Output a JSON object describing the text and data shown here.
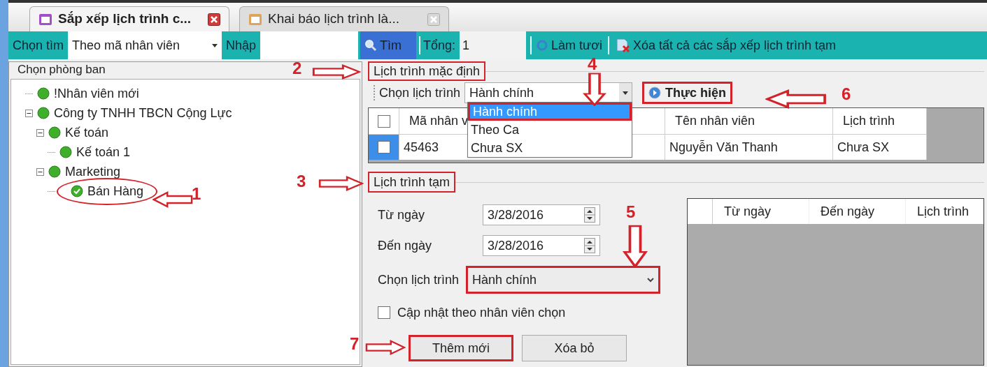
{
  "tabs": [
    {
      "label": "Sắp xếp lịch trình c...",
      "selected": true
    },
    {
      "label": "Khai báo lịch trình là...",
      "selected": false
    }
  ],
  "toolbar": {
    "search_by_label": "Chọn tìm",
    "search_by_value": "Theo mã nhân viên",
    "input_label": "Nhập",
    "search_button": "Tìm",
    "total_label": "Tổng:",
    "total_value": "1",
    "refresh_button": "Làm tươi",
    "clear_button": "Xóa tất cả các sắp xếp lịch trình tạm"
  },
  "department_panel": {
    "title": "Chọn phòng ban",
    "tree": [
      {
        "label": "!Nhân viên mới",
        "selected": false,
        "highlighted": false
      },
      {
        "label": "Công ty TNHH TBCN Cộng Lực",
        "selected": false,
        "highlighted": false,
        "expanded": true,
        "children": [
          {
            "label": "Kế toán",
            "selected": false,
            "highlighted": false,
            "expanded": true,
            "children": [
              {
                "label": "Kế toán 1",
                "selected": false,
                "highlighted": false
              }
            ]
          },
          {
            "label": "Marketing",
            "selected": false,
            "highlighted": false,
            "expanded": true,
            "children": [
              {
                "label": "Bán Hàng",
                "selected": true,
                "highlighted": true
              }
            ]
          }
        ]
      }
    ]
  },
  "default_schedule": {
    "title": "Lịch trình mặc định",
    "highlighted": true,
    "schedule_label": "Chọn lịch trình",
    "schedule_value": "Hành chính",
    "dropdown_open": true,
    "options": [
      {
        "label": "Hành chính",
        "selected": true,
        "highlighted": true
      },
      {
        "label": "Theo Ca",
        "selected": false,
        "highlighted": false
      },
      {
        "label": "Chưa SX",
        "selected": false,
        "highlighted": false
      }
    ],
    "run_button": {
      "label": "Thực hiện",
      "highlighted": true
    },
    "table": {
      "header_checked": false,
      "columns": [
        "Mã nhân v",
        "Tên nhân viên",
        "Lịch trình"
      ],
      "rows": [
        {
          "selected": true,
          "checked": false,
          "cells": [
            "45463",
            "Nguyễn Văn Thanh",
            "Chưa SX"
          ]
        }
      ]
    }
  },
  "temp_schedule": {
    "title": "Lịch trình tạm",
    "highlighted": true,
    "from_label": "Từ ngày",
    "from_value": "3/28/2016",
    "to_label": "Đến ngày",
    "to_value": "3/28/2016",
    "schedule_label": "Chọn lịch trình",
    "schedule_value": "Hành chính",
    "schedule_highlighted": true,
    "update_checkbox": {
      "label": "Cập nhật theo nhân viên chọn",
      "checked": false
    },
    "buttons": [
      {
        "label": "Thêm mới",
        "highlighted": true
      },
      {
        "label": "Xóa bỏ",
        "highlighted": false
      }
    ],
    "table": {
      "columns": [
        "Từ ngày",
        "Đến ngày",
        "Lịch trình"
      ]
    }
  },
  "annotations": [
    {
      "number": "1",
      "kind": "left"
    },
    {
      "number": "2",
      "kind": "right"
    },
    {
      "number": "3",
      "kind": "right"
    },
    {
      "number": "4",
      "kind": "down"
    },
    {
      "number": "5",
      "kind": "down"
    },
    {
      "number": "6",
      "kind": "left"
    },
    {
      "number": "7",
      "kind": "right"
    }
  ]
}
